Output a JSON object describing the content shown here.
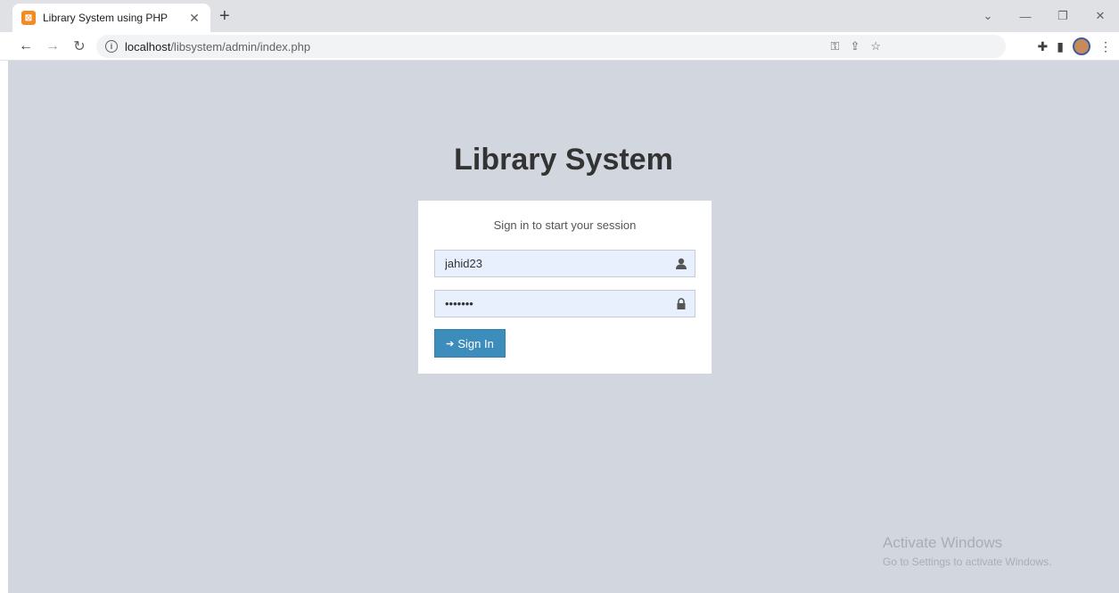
{
  "browser": {
    "tab_title": "Library System using PHP",
    "favicon_text": "⊠",
    "url_host": "localhost",
    "url_path": "/libsystem/admin/index.php"
  },
  "page": {
    "title": "Library System",
    "login_msg": "Sign in to start your session",
    "username_value": "jahid23",
    "password_value": "•••••••",
    "signin_label": "Sign In"
  },
  "watermark": {
    "line1": "Activate Windows",
    "line2": "Go to Settings to activate Windows."
  },
  "colors": {
    "page_bg": "#d2d6de",
    "button": "#3c8dbc",
    "field_bg": "#e8f0fe"
  }
}
